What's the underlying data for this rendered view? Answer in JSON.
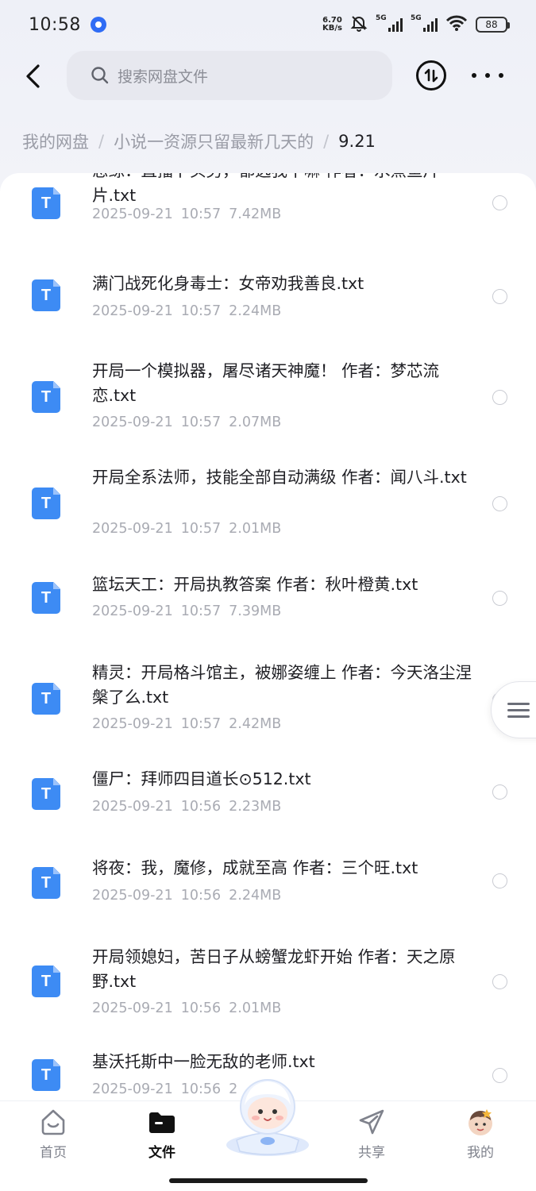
{
  "status_bar": {
    "time": "10:58",
    "net_speed_value": "6.70",
    "net_speed_unit": "KB/s",
    "sim1": "5G",
    "sim2": "5G",
    "battery": "88",
    "icons": [
      "app-notification-icon",
      "mute-icon",
      "signal-icon",
      "wifi-icon",
      "battery-icon"
    ]
  },
  "header": {
    "search_placeholder": "搜索网盘文件",
    "icons": [
      "back-icon",
      "search-icon",
      "transfer-icon",
      "more-icon"
    ]
  },
  "breadcrumb": {
    "items": [
      "我的网盘",
      "小说一资源只留最新几天的"
    ],
    "current": "9.21"
  },
  "files": [
    {
      "name": "恋综：直播卜头男，都选我干嘛 作者：水煮鱼片片.txt",
      "date": "2025-09-21",
      "time": "10:57",
      "size": "7.42MB"
    },
    {
      "name": "满门战死化身毒士：女帝劝我善良.txt",
      "date": "2025-09-21",
      "time": "10:57",
      "size": "2.24MB"
    },
    {
      "name": "开局一个模拟器，屠尽诸天神魔！ 作者：梦芯流恋.txt",
      "date": "2025-09-21",
      "time": "10:57",
      "size": "2.07MB"
    },
    {
      "name": "开局全系法师，技能全部自动满级 作者：闻八斗.txt",
      "date": "2025-09-21",
      "time": "10:57",
      "size": "2.01MB"
    },
    {
      "name": "篮坛天工：开局执教答案 作者：秋叶橙黄.txt",
      "date": "2025-09-21",
      "time": "10:57",
      "size": "7.39MB"
    },
    {
      "name": "精灵：开局格斗馆主，被娜姿缠上 作者：今天洛尘涅槃了么.txt",
      "date": "2025-09-21",
      "time": "10:57",
      "size": "2.42MB"
    },
    {
      "name": "僵尸：拜师四目道长⊙512.txt",
      "date": "2025-09-21",
      "time": "10:56",
      "size": "2.23MB"
    },
    {
      "name": "将夜：我，魔修，成就至高 作者：三个旺.txt",
      "date": "2025-09-21",
      "time": "10:56",
      "size": "2.24MB"
    },
    {
      "name": "开局领媳妇，苦日子从螃蟹龙虾开始 作者：天之原野.txt",
      "date": "2025-09-21",
      "time": "10:56",
      "size": "2.01MB"
    },
    {
      "name": "基沃托斯中一脸无敌的老师.txt",
      "date": "2025-09-21",
      "time": "10:56",
      "size": "2"
    }
  ],
  "file_icon_letter": "T",
  "bottom_nav": {
    "items": [
      {
        "label": "首页",
        "icon": "home-icon"
      },
      {
        "label": "文件",
        "icon": "folder-icon",
        "active": true
      },
      {
        "label": "",
        "icon": "mascot-icon"
      },
      {
        "label": "共享",
        "icon": "share-icon"
      },
      {
        "label": "我的",
        "icon": "avatar-icon"
      }
    ]
  },
  "colors": {
    "accent": "#3d8bf4",
    "text_primary": "#1f1f24",
    "text_secondary": "#a9abb3"
  }
}
